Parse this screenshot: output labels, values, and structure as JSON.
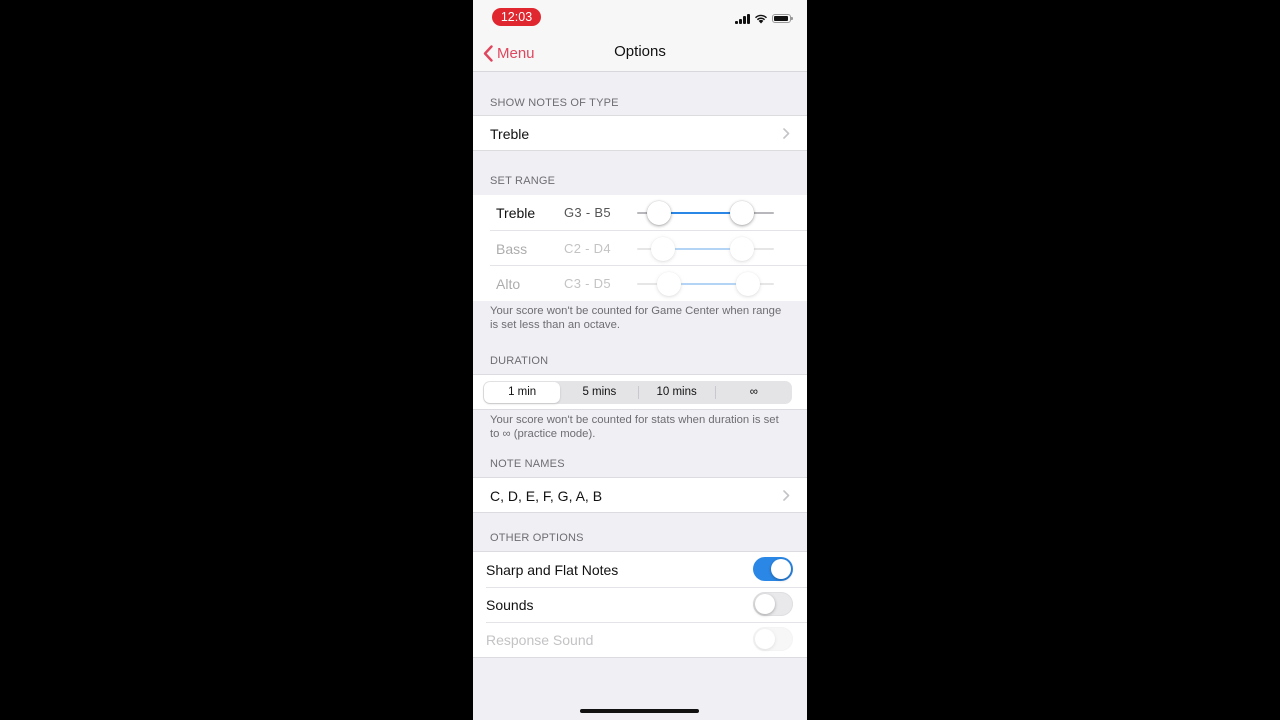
{
  "status": {
    "time": "12:03"
  },
  "nav": {
    "back_label": "Menu",
    "title": "Options"
  },
  "show_notes": {
    "header": "SHOW NOTES OF TYPE",
    "value": "Treble"
  },
  "set_range": {
    "header": "SET RANGE",
    "rows": [
      {
        "name": "Treble",
        "range": "G3 - B5",
        "low": 0.16,
        "high": 0.77,
        "enabled": true
      },
      {
        "name": "Bass",
        "range": "C2 - D4",
        "low": 0.19,
        "high": 0.77,
        "enabled": false
      },
      {
        "name": "Alto",
        "range": "C3 - D5",
        "low": 0.23,
        "high": 0.81,
        "enabled": false
      }
    ],
    "note": "Your score won't be counted for Game Center when range is set less than an octave."
  },
  "duration": {
    "header": "DURATION",
    "options": [
      "1 min",
      "5 mins",
      "10 mins",
      "∞"
    ],
    "selected": "1 min",
    "note": "Your score won't be counted for stats when duration is set to ∞ (practice mode)."
  },
  "note_names": {
    "header": "NOTE NAMES",
    "value": "C, D, E, F, G, A, B"
  },
  "other_options": {
    "header": "OTHER OPTIONS",
    "toggles": [
      {
        "label": "Sharp and Flat Notes",
        "on": true,
        "enabled": true
      },
      {
        "label": "Sounds",
        "on": false,
        "enabled": true
      },
      {
        "label": "Response Sound",
        "on": false,
        "enabled": false
      }
    ]
  },
  "colors": {
    "accent": "#2b87e6",
    "back_tint": "#e0475e",
    "time_pill": "#e0262f"
  }
}
